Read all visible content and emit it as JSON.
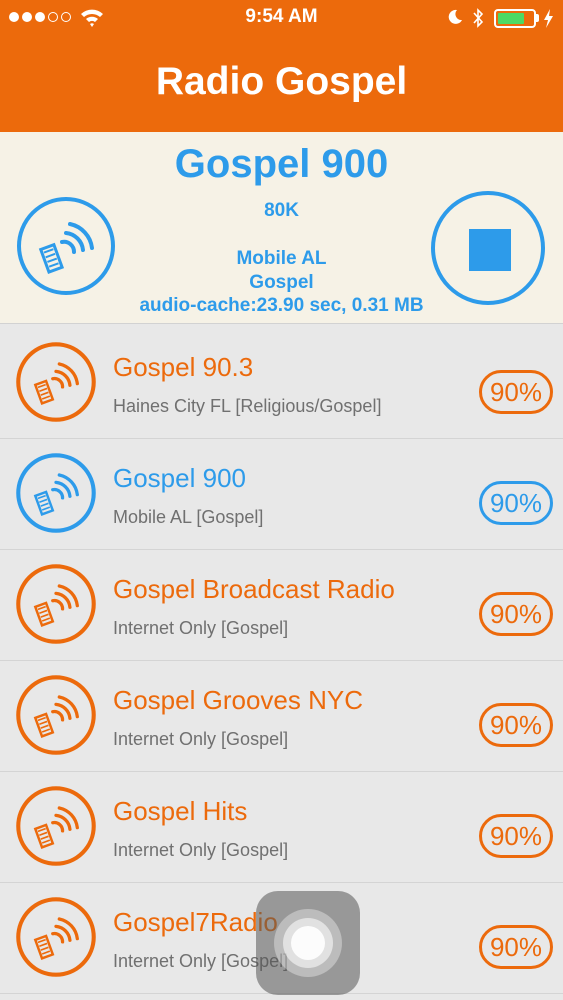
{
  "status_bar": {
    "time": "9:54 AM",
    "signal_dots_filled": 3,
    "signal_dots_total": 5,
    "battery_level": 0.72
  },
  "header": {
    "title": "Radio Gospel"
  },
  "now_playing": {
    "station": "Gospel 900",
    "bitrate": "80K",
    "location": "Mobile AL",
    "genre": "Gospel",
    "cache": "audio-cache:23.90 sec, 0.31 MB"
  },
  "stations": [
    {
      "name": "Gospel 90.3",
      "subtitle": "Haines City FL [Religious/Gospel]",
      "percent": "90%",
      "active": false
    },
    {
      "name": "Gospel 900",
      "subtitle": "Mobile AL [Gospel]",
      "percent": "90%",
      "active": true
    },
    {
      "name": "Gospel Broadcast Radio",
      "subtitle": "Internet Only [Gospel]",
      "percent": "90%",
      "active": false
    },
    {
      "name": "Gospel Grooves NYC",
      "subtitle": "Internet Only [Gospel]",
      "percent": "90%",
      "active": false
    },
    {
      "name": "Gospel Hits",
      "subtitle": "Internet Only [Gospel]",
      "percent": "90%",
      "active": false
    },
    {
      "name": "Gospel7Radio",
      "subtitle": "Internet Only [Gospel]",
      "percent": "90%",
      "active": false
    }
  ],
  "icons": {
    "radio": "radio-wave-icon",
    "stop": "stop-icon",
    "wifi": "wifi-icon",
    "bluetooth": "bluetooth-icon",
    "moon": "do-not-disturb-icon",
    "battery": "battery-icon",
    "charging": "charging-bolt-icon"
  },
  "colors": {
    "brand_orange": "#ec6a0c",
    "active_blue": "#2d9bea",
    "now_playing_bg": "#f6f2e6",
    "list_bg": "#e8e8e8"
  }
}
